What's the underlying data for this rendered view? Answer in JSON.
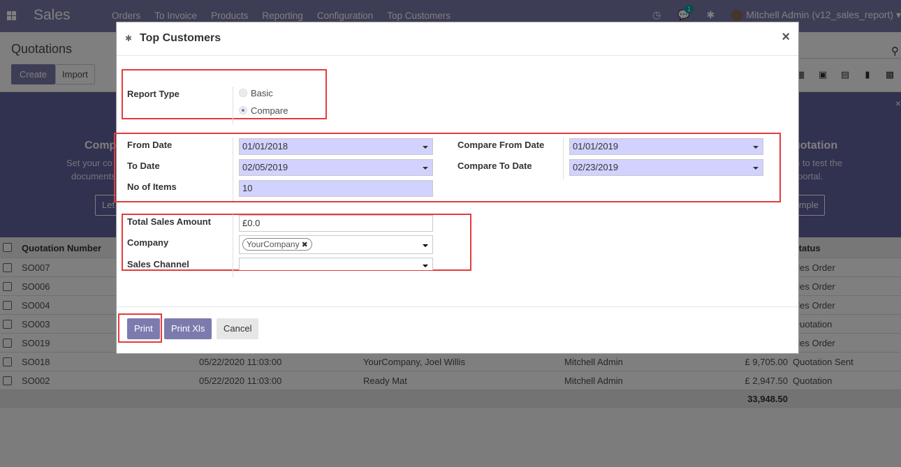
{
  "navbar": {
    "brand": "Sales",
    "menu": [
      "Orders",
      "To Invoice",
      "Products",
      "Reporting",
      "Configuration",
      "Top Customers"
    ],
    "chat_badge": "1",
    "user": "Mitchell Admin (v12_sales_report)"
  },
  "control": {
    "title": "Quotations",
    "create": "Create",
    "import": "Import"
  },
  "banner": {
    "left_title": "Comp",
    "left_line1": "Set your co",
    "left_line2": "documents",
    "left_button": "Let",
    "right_title": "uotation",
    "right_line1": "n to test the",
    "right_line2": "portal.",
    "right_button": "mple"
  },
  "table": {
    "headers": {
      "number": "Quotation Number",
      "status": "Status"
    },
    "rows": [
      {
        "number": "SO007",
        "date": "",
        "customer": "",
        "salesperson": "",
        "total": "",
        "status": "ales Order"
      },
      {
        "number": "SO006",
        "date": "",
        "customer": "",
        "salesperson": "",
        "total": "",
        "status": "ales Order"
      },
      {
        "number": "SO004",
        "date": "",
        "customer": "",
        "salesperson": "",
        "total": "",
        "status": "ales Order"
      },
      {
        "number": "SO003",
        "date": "",
        "customer": "",
        "salesperson": "",
        "total": "",
        "status": "Quotation"
      },
      {
        "number": "SO019",
        "date": "",
        "customer": "",
        "salesperson": "",
        "total": "",
        "status": "ales Order"
      },
      {
        "number": "SO018",
        "date": "05/22/2020 11:03:00",
        "customer": "YourCompany, Joel Willis",
        "salesperson": "Mitchell Admin",
        "total": "£ 9,705.00",
        "status": "Quotation Sent"
      },
      {
        "number": "SO002",
        "date": "05/22/2020 11:03:00",
        "customer": "Ready Mat",
        "salesperson": "Mitchell Admin",
        "total": "£ 2,947.50",
        "status": "Quotation"
      }
    ],
    "footer_total": "33,948.50"
  },
  "modal": {
    "title": "Top Customers",
    "report_type_label": "Report Type",
    "option_basic": "Basic",
    "option_compare": "Compare",
    "selected_option": "Compare",
    "from_date_label": "From Date",
    "from_date": "01/01/2018",
    "to_date_label": "To Date",
    "to_date": "02/05/2019",
    "items_label": "No of Items",
    "items": "10",
    "compare_from_label": "Compare From Date",
    "compare_from": "01/01/2019",
    "compare_to_label": "Compare To Date",
    "compare_to": "02/23/2019",
    "total_label": "Total Sales Amount",
    "total": "£0.0",
    "company_label": "Company",
    "company_tag": "YourCompany",
    "channel_label": "Sales Channel",
    "channel": "",
    "print": "Print",
    "print_xls": "Print Xls",
    "cancel": "Cancel"
  },
  "colors": {
    "primary": "#7c7bad",
    "highlight": "#e53b3b",
    "required_field": "#d2d2ff"
  }
}
